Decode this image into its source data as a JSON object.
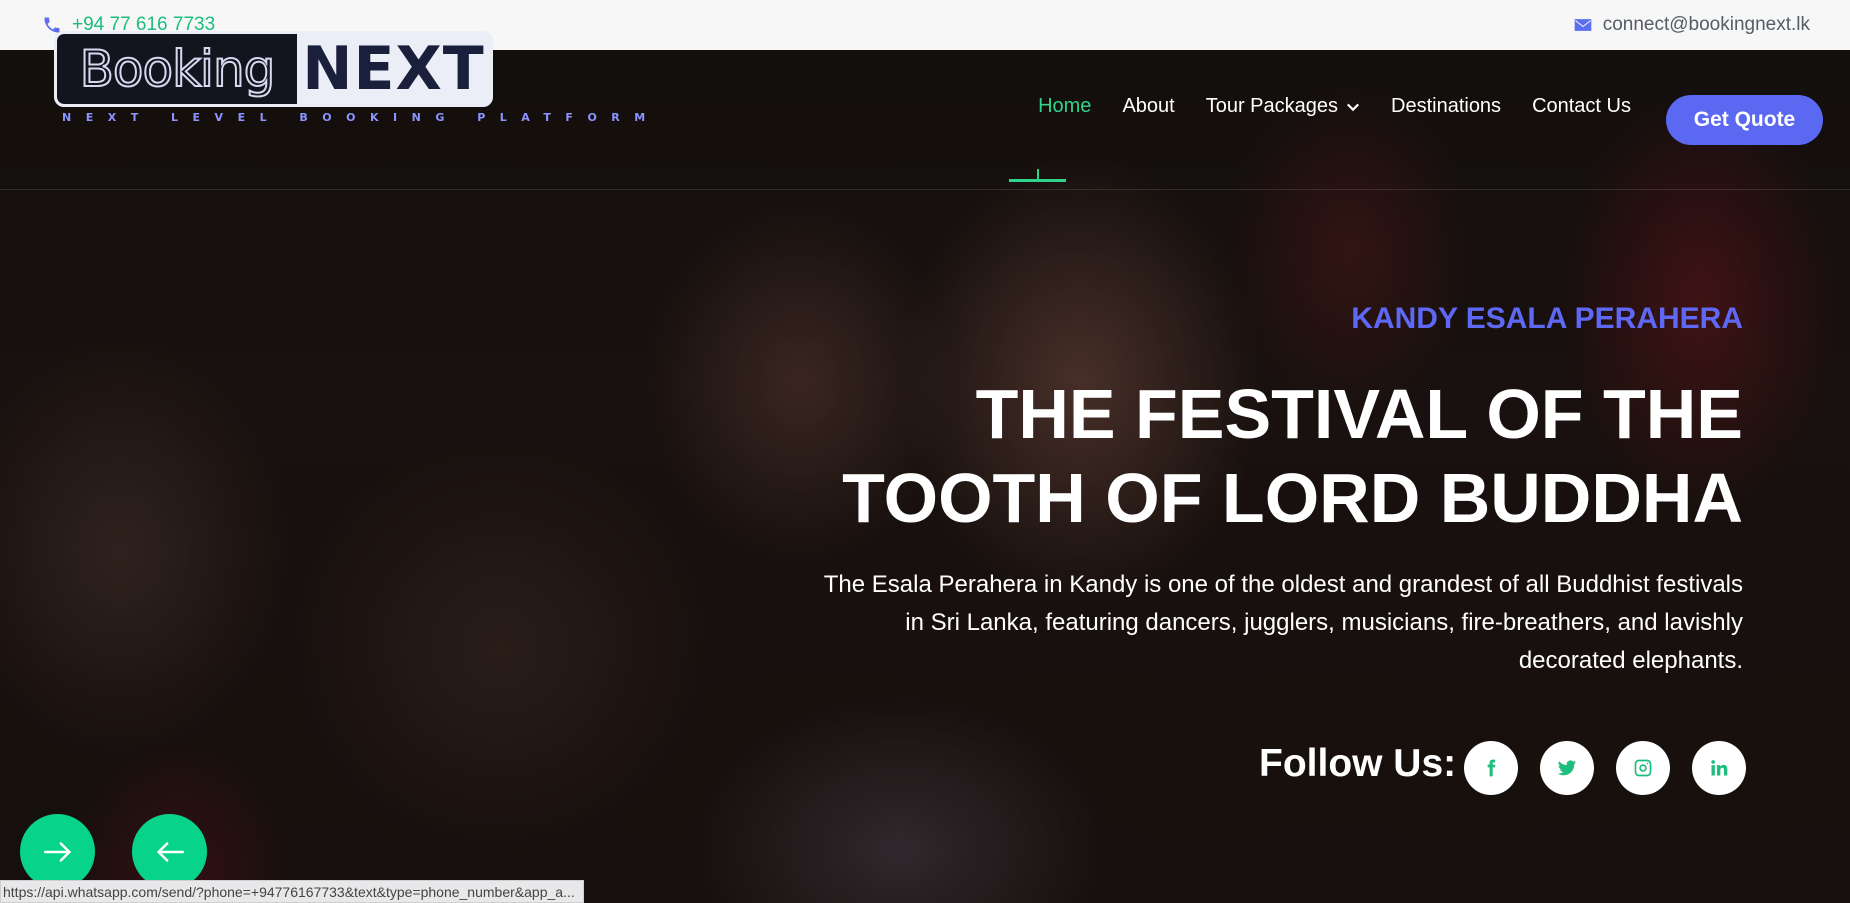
{
  "topbar": {
    "phone": "+94 77 616 7733",
    "email": "connect@bookingnext.lk"
  },
  "logo": {
    "left_text": "Booking",
    "right_text": "NEXT",
    "tagline": "NEXT LEVEL BOOKING PLATFORM"
  },
  "nav": {
    "items": [
      {
        "label": "Home",
        "active": true
      },
      {
        "label": "About"
      },
      {
        "label": "Tour Packages",
        "dropdown": true
      },
      {
        "label": "Destinations"
      },
      {
        "label": "Contact Us"
      }
    ],
    "cta": "Get Quote"
  },
  "hero": {
    "kicker": "KANDY ESALA PERAHERA",
    "headline_line1": "THE FESTIVAL OF THE",
    "headline_line2": "TOOTH OF LORD BUDDHA",
    "description": "The Esala Perahera in Kandy is one of the oldest and grandest of all Buddhist festivals in Sri Lanka, featuring dancers, jugglers, musicians, fire-breathers, and lavishly decorated elephants.",
    "follow_label": "Follow Us:",
    "socials": [
      "facebook-icon",
      "twitter-icon",
      "instagram-icon",
      "linkedin-icon"
    ]
  },
  "status_url": "https://api.whatsapp.com/send/?phone=+94776167733&text&type=phone_number&app_a...",
  "colors": {
    "accent_green": "#2fd38a",
    "accent_blue": "#5a68f2",
    "kicker_blue": "#5e68f5"
  }
}
